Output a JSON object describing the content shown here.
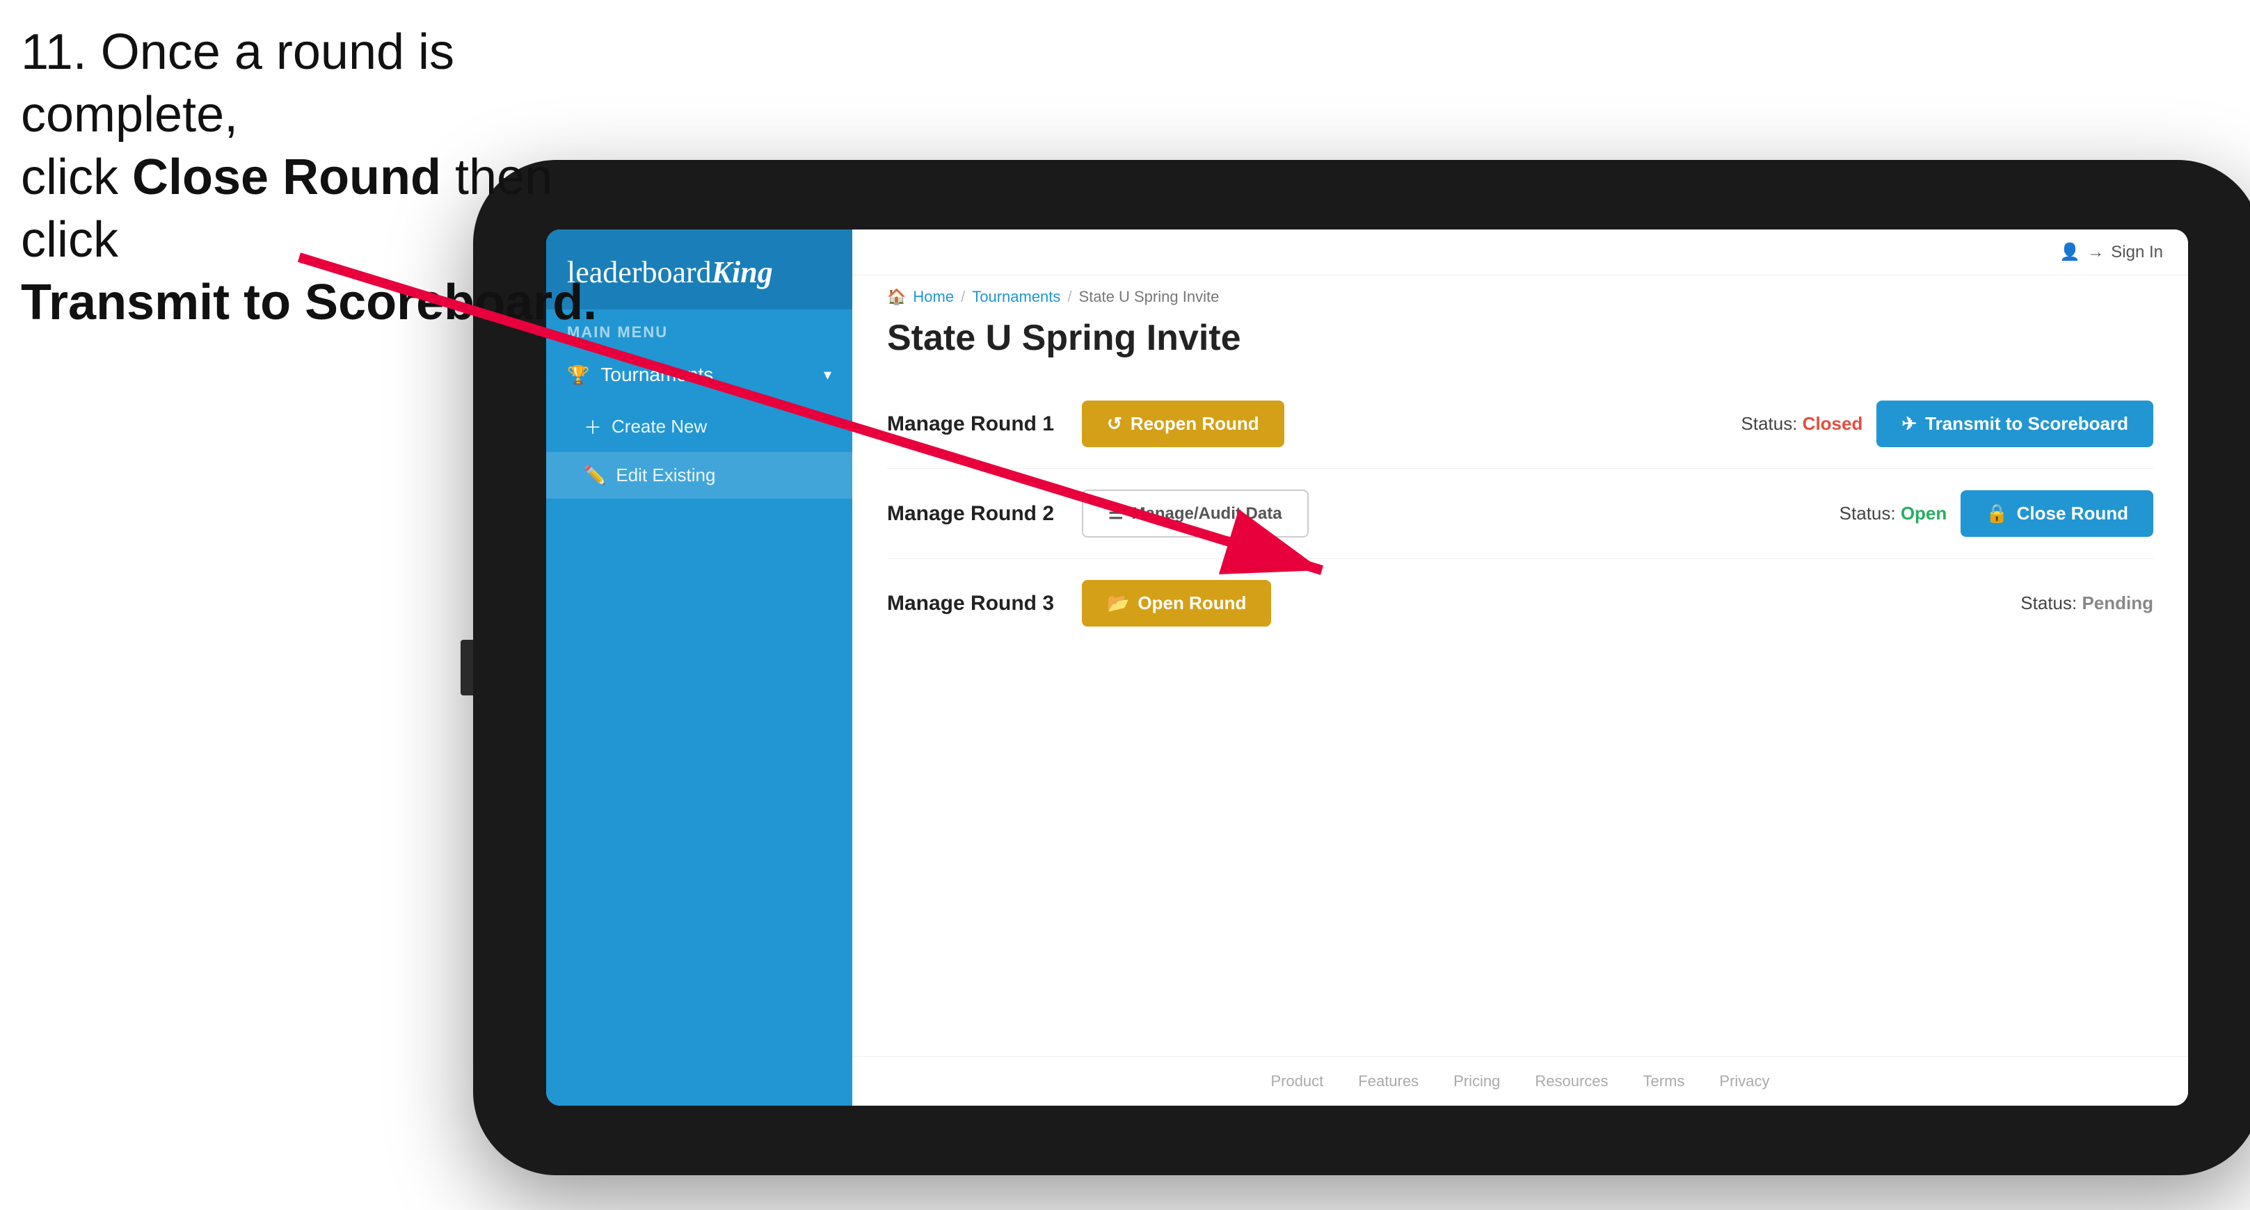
{
  "instruction": {
    "line1": "11. Once a round is complete,",
    "line2_prefix": "click ",
    "line2_bold": "Close Round",
    "line2_suffix": " then click",
    "line3_bold": "Transmit to Scoreboard."
  },
  "sidebar": {
    "logo": "leaderboard",
    "logo_king": "King",
    "main_menu_label": "MAIN MENU",
    "tournaments_label": "Tournaments",
    "create_new_label": "Create New",
    "edit_existing_label": "Edit Existing"
  },
  "topbar": {
    "signin_label": "Sign In"
  },
  "breadcrumb": {
    "home": "Home",
    "tournaments": "Tournaments",
    "current": "State U Spring Invite"
  },
  "page_title": "State U Spring Invite",
  "rounds": [
    {
      "id": "round1",
      "title": "Manage Round 1",
      "status_label": "Status:",
      "status_value": "Closed",
      "status_type": "closed",
      "buttons": [
        {
          "id": "reopen",
          "label": "Reopen Round",
          "style": "gold",
          "icon": "↺"
        }
      ],
      "right_buttons": [
        {
          "id": "transmit",
          "label": "Transmit to Scoreboard",
          "style": "blue",
          "icon": "✈"
        }
      ]
    },
    {
      "id": "round2",
      "title": "Manage Round 2",
      "status_label": "Status:",
      "status_value": "Open",
      "status_type": "open",
      "buttons": [
        {
          "id": "audit",
          "label": "Manage/Audit Data",
          "style": "outline-gray",
          "icon": "☰"
        }
      ],
      "right_buttons": [
        {
          "id": "close",
          "label": "Close Round",
          "style": "blue",
          "icon": "🔒"
        }
      ]
    },
    {
      "id": "round3",
      "title": "Manage Round 3",
      "status_label": "Status:",
      "status_value": "Pending",
      "status_type": "pending",
      "buttons": [
        {
          "id": "open",
          "label": "Open Round",
          "style": "gold",
          "icon": "📂"
        }
      ],
      "right_buttons": []
    }
  ],
  "footer": {
    "links": [
      "Product",
      "Features",
      "Pricing",
      "Resources",
      "Terms",
      "Privacy"
    ]
  }
}
